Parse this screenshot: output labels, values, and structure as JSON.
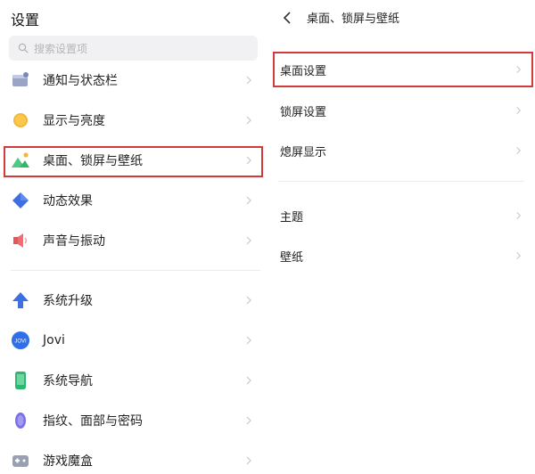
{
  "left": {
    "title": "设置",
    "search_placeholder": "搜索设置项",
    "items": [
      {
        "label": "通知与状态栏",
        "icon": "notification-icon"
      },
      {
        "label": "显示与亮度",
        "icon": "display-brightness-icon"
      },
      {
        "label": "桌面、锁屏与壁纸",
        "icon": "wallpaper-icon"
      },
      {
        "label": "动态效果",
        "icon": "dynamic-effect-icon"
      },
      {
        "label": "声音与振动",
        "icon": "sound-icon"
      },
      {
        "label": "系统升级",
        "icon": "system-update-icon"
      },
      {
        "label": "Jovi",
        "icon": "jovi-icon"
      },
      {
        "label": "系统导航",
        "icon": "system-navigation-icon"
      },
      {
        "label": "指纹、面部与密码",
        "icon": "fingerprint-icon"
      },
      {
        "label": "游戏魔盒",
        "icon": "game-box-icon"
      }
    ],
    "jovi_badge": "JOVI"
  },
  "right": {
    "title": "桌面、锁屏与壁纸",
    "items": [
      {
        "label": "桌面设置"
      },
      {
        "label": "锁屏设置"
      },
      {
        "label": "熄屏显示"
      },
      {
        "label": "主题"
      },
      {
        "label": "壁纸"
      }
    ]
  },
  "colors": {
    "highlight": "#cf3b3b",
    "separator": "#ececec",
    "chevron": "#c8c8c8"
  }
}
